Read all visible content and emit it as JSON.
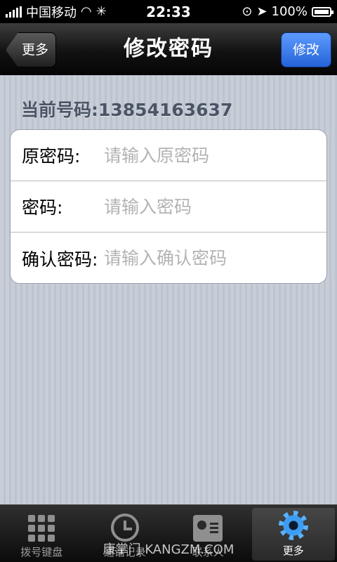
{
  "status": {
    "carrier": "中国移动",
    "time": "22:33",
    "battery": "100%"
  },
  "nav": {
    "title": "修改密码",
    "back_label": "更多",
    "action_label": "修改"
  },
  "account": {
    "phone_text": "当前号码:13854163637"
  },
  "form": {
    "rows": [
      {
        "label": "原密码:",
        "placeholder": "请输入原密码"
      },
      {
        "label": "密码:",
        "placeholder": "请输入密码"
      },
      {
        "label": "确认密码:",
        "placeholder": "请输入确认密码"
      }
    ]
  },
  "tabs": [
    {
      "label": "拨号键盘",
      "icon": "dialpad-icon"
    },
    {
      "label": "通话记录",
      "icon": "clock-icon"
    },
    {
      "label": "联系人",
      "icon": "contacts-icon"
    },
    {
      "label": "更多",
      "icon": "gear-icon"
    }
  ],
  "watermark": "康掌门 KANGZM.COM",
  "colors": {
    "accent": "#2f6fe0",
    "active_tab_icon": "#3d9df2"
  }
}
